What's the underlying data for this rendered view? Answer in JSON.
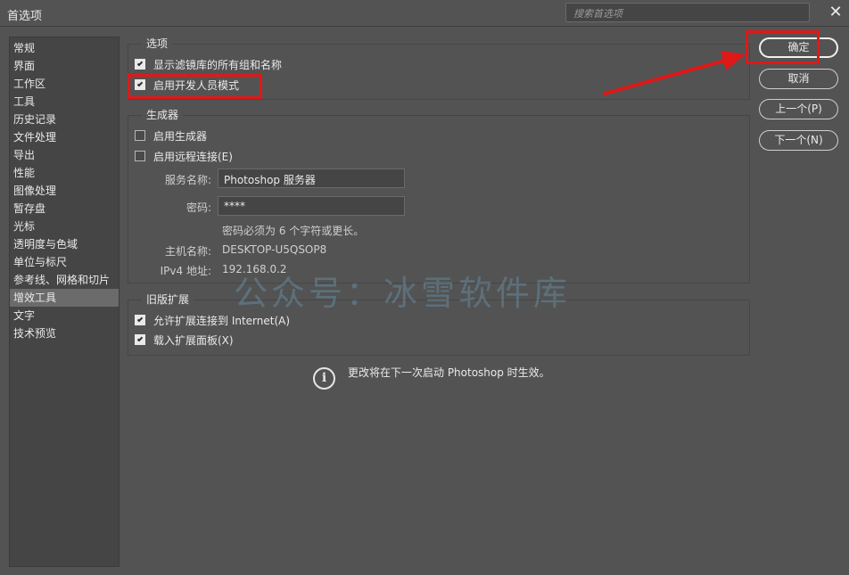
{
  "window": {
    "title": "首选项",
    "close": "✕"
  },
  "search": {
    "placeholder": "搜索首选项"
  },
  "sidebar": {
    "items": [
      "常规",
      "界面",
      "工作区",
      "工具",
      "历史记录",
      "文件处理",
      "导出",
      "性能",
      "图像处理",
      "暂存盘",
      "光标",
      "透明度与色域",
      "单位与标尺",
      "参考线、网格和切片",
      "增效工具",
      "文字",
      "技术预览"
    ],
    "active_index": 14
  },
  "options": {
    "title": "选项",
    "show_all_filter_groups": {
      "label": "显示滤镜库的所有组和名称",
      "checked": true
    },
    "developer_mode": {
      "label": "启用开发人员模式",
      "checked": true
    }
  },
  "generator": {
    "title": "生成器",
    "enable_generator": {
      "label": "启用生成器",
      "checked": false
    },
    "enable_remote": {
      "label": "启用远程连接(E)",
      "checked": false
    },
    "service_name_label": "服务名称:",
    "service_name_value": "Photoshop 服务器",
    "password_label": "密码:",
    "password_value": "****",
    "password_hint": "密码必须为 6 个字符或更长。",
    "host_label": "主机名称:",
    "host_value": "DESKTOP-U5QSOP8",
    "ipv4_label": "IPv4 地址:",
    "ipv4_value": "192.168.0.2"
  },
  "legacy": {
    "title": "旧版扩展",
    "allow_internet": {
      "label": "允许扩展连接到 Internet(A)",
      "checked": true
    },
    "load_panels": {
      "label": "载入扩展面板(X)",
      "checked": true
    }
  },
  "info": "更改将在下一次启动 Photoshop 时生效。",
  "buttons": {
    "ok": "确定",
    "cancel": "取消",
    "prev": "上一个(P)",
    "next": "下一个(N)"
  },
  "watermark": "公众号：冰雪软件库",
  "colors": {
    "background": "#535353",
    "panel": "#454545",
    "highlight": "#e01818"
  }
}
